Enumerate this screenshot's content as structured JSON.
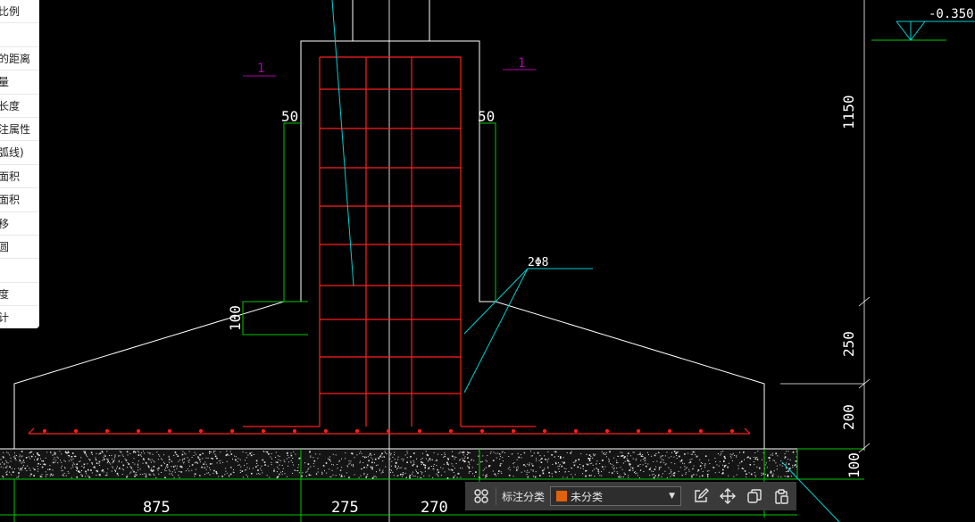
{
  "menu": {
    "items": [
      {
        "label": "比例",
        "icon": "scale-icon"
      },
      {
        "label": "",
        "icon": "blank"
      },
      {
        "label": "的距离",
        "icon": "distance-icon"
      },
      {
        "label": "量",
        "icon": "measure-icon"
      },
      {
        "label": "长度",
        "icon": "length-icon"
      },
      {
        "label": "注属性",
        "icon": "attribute-icon"
      },
      {
        "label": "弧线)",
        "icon": "arc-icon"
      },
      {
        "label": "面积",
        "icon": "area-icon"
      },
      {
        "label": "面积",
        "icon": "area-icon"
      },
      {
        "label": "移",
        "icon": "move-icon"
      },
      {
        "label": "圆",
        "icon": "circle-icon"
      },
      {
        "label": "",
        "icon": "blank"
      },
      {
        "label": "度",
        "icon": "angle-icon"
      },
      {
        "label": "计",
        "icon": "count-icon"
      }
    ]
  },
  "drawing": {
    "elevation_label": "-0.350",
    "section_marks": [
      "1",
      "1"
    ],
    "offset_labels": [
      "50",
      "50"
    ],
    "rebar_label": "2Φ8",
    "left_dim": "100",
    "right_dims": [
      "1150",
      "250",
      "200",
      "100"
    ],
    "bottom_dims": [
      "875",
      "275",
      "270"
    ]
  },
  "toolbar": {
    "label": "标注分类",
    "select_value": "未分类",
    "swatch_color": "#e0620e"
  },
  "colors": {
    "background": "#000000",
    "outline": "#ffffff",
    "rebar": "#ff2020",
    "dimension": "#00c800",
    "leader": "#00d0d0",
    "section_mark": "#b000b0"
  }
}
